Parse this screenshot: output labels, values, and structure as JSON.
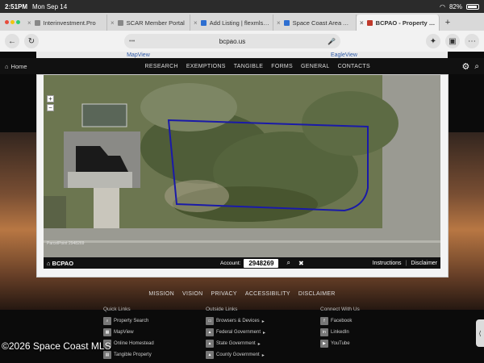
{
  "status": {
    "time": "2:51PM",
    "date": "Mon Sep 14",
    "battery": "82%"
  },
  "tabs": [
    {
      "title": "Interinvestment.Pro",
      "active": false
    },
    {
      "title": "SCAR Member Portal",
      "active": false
    },
    {
      "title": "Add Listing | flexmls Web",
      "active": false
    },
    {
      "title": "Space Coast Area Assoc",
      "active": false
    },
    {
      "title": "BCPAO - Property Search",
      "active": true
    }
  ],
  "address": {
    "url": "bcpao.us"
  },
  "topstrip": {
    "mapview": "MapView",
    "eagleview": "EagleView"
  },
  "nav": {
    "home": "Home",
    "links": [
      "RESEARCH",
      "EXEMPTIONS",
      "TANGIBLE",
      "FORMS",
      "GENERAL",
      "CONTACTS"
    ]
  },
  "map": {
    "caption": "ParcelPoint 2948269",
    "brand": "BCPAO",
    "account_label": "Account:",
    "account_value": "2948269",
    "instructions": "Instructions",
    "disclaimer": "Disclaimer"
  },
  "footer": {
    "links": [
      "MISSION",
      "VISION",
      "PRIVACY",
      "ACCESSIBILITY",
      "DISCLAIMER"
    ],
    "quick": {
      "title": "Quick Links",
      "items": [
        "Property Search",
        "MapView",
        "Online Homestead",
        "Tangible Property"
      ]
    },
    "outside": {
      "title": "Outside Links",
      "items": [
        "Browsers & Devices",
        "Federal Government",
        "State Government",
        "County Government"
      ]
    },
    "connect": {
      "title": "Connect With Us",
      "items": [
        "Facebook",
        "LinkedIn",
        "YouTube"
      ]
    }
  },
  "watermark": "©2026 Space Coast MLS"
}
